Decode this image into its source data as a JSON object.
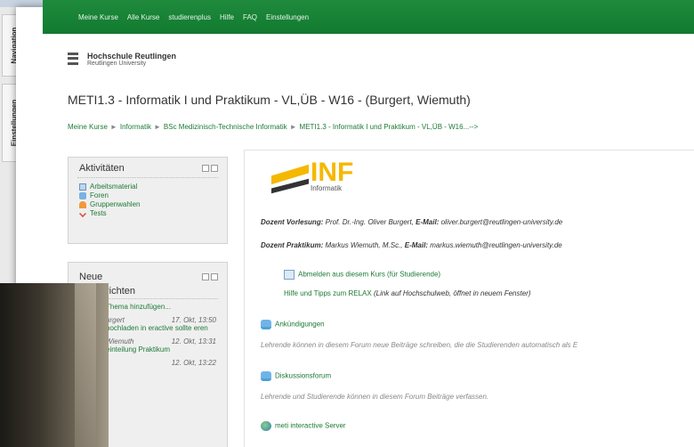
{
  "side_tabs": {
    "navigation": "Navigation",
    "settings": "Einstellungen"
  },
  "topnav": [
    "Meine Kurse",
    "Alle Kurse",
    "studierenplus",
    "Hilfe",
    "FAQ",
    "Einstellungen"
  ],
  "university": {
    "name": "Hochschule Reutlingen",
    "sub": "Reutlingen University"
  },
  "course_title": "METI1.3 - Informatik I und Praktikum - VL,ÜB - W16 - (Burgert, Wiemuth)",
  "breadcrumb": [
    "Meine Kurse",
    "Informatik",
    "BSc Medizinisch-Technische Informatik",
    "METI1.3 - Informatik I und Praktikum - VL,ÜB - W16...-->"
  ],
  "activities": {
    "title": "Aktivitäten",
    "items": [
      "Arbeitsmaterial",
      "Foren",
      "Gruppenwahlen",
      "Tests"
    ]
  },
  "news": {
    "title_line1": "Neue",
    "title_line2": "richten",
    "add_topic": "Thema hinzufügen...",
    "entries": [
      {
        "author": "urgert",
        "date": "17. Okt, 13:50",
        "text": "hochladen in eractive sollte eren"
      },
      {
        "author": "Wiemuth",
        "date": "12. Okt, 13:31",
        "text": "einteilung Praktikum"
      },
      {
        "author": "",
        "date": "12. Okt, 13:22",
        "text": ""
      }
    ]
  },
  "main": {
    "logo_text": "INF",
    "logo_sub": "Informatik",
    "dozent_vl_label": "Dozent Vorlesung:",
    "dozent_vl_value": "Prof. Dr.-Ing. Oliver Burgert,",
    "email_label": "E-Mail:",
    "dozent_vl_email": "oliver.burgert@reutlingen-university.de",
    "dozent_pr_label": "Dozent Praktikum:",
    "dozent_pr_value": "Markus Wiemuth, M.Sc.,",
    "dozent_pr_email": "markus.wiemuth@reutlingen-university.de",
    "unsubscribe": "Abmelden aus diesem Kurs (für Studierende)",
    "relax_link": "Hilfe und Tipps zum RELAX",
    "relax_note": "(Link auf Hochschulweb, öffnet in neuem Fenster)",
    "announcements": "Ankündigungen",
    "announcements_desc": "Lehrende können in diesem Forum neue Beiträge schreiben, die die Studierenden automatisch als E",
    "discussion": "Diskussionsforum",
    "discussion_desc": "Lehrende und Studierende können in diesem Forum Beiträge verfassen.",
    "server": "meti interactive Server"
  }
}
